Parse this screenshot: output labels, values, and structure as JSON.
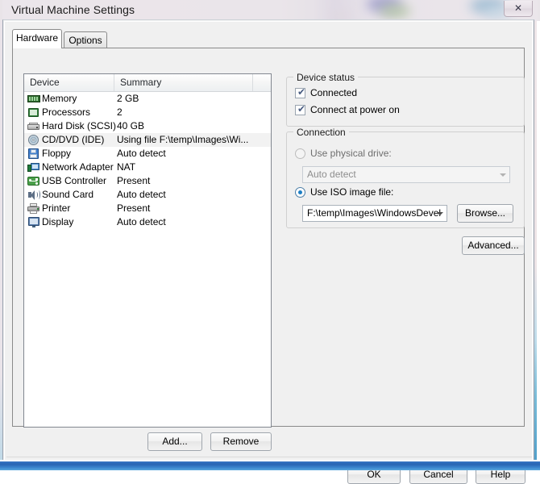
{
  "window": {
    "title": "Virtual Machine Settings",
    "close_label": "✕",
    "close_icon": "close-icon"
  },
  "tabs": [
    {
      "label": "Hardware",
      "active": true
    },
    {
      "label": "Options",
      "active": false
    }
  ],
  "device_list": {
    "columns": [
      "Device",
      "Summary",
      ""
    ],
    "rows": [
      {
        "icon": "memory-icon",
        "device": "Memory",
        "summary": "2 GB",
        "selected": false
      },
      {
        "icon": "processor-icon",
        "device": "Processors",
        "summary": "2",
        "selected": false
      },
      {
        "icon": "hard-disk-icon",
        "device": "Hard Disk (SCSI)",
        "summary": "40 GB",
        "selected": false
      },
      {
        "icon": "cd-dvd-icon",
        "device": "CD/DVD (IDE)",
        "summary": "Using file F:\\temp\\Images\\Wi...",
        "selected": true
      },
      {
        "icon": "floppy-icon",
        "device": "Floppy",
        "summary": "Auto detect",
        "selected": false
      },
      {
        "icon": "network-adapter-icon",
        "device": "Network Adapter",
        "summary": "NAT",
        "selected": false
      },
      {
        "icon": "usb-controller-icon",
        "device": "USB Controller",
        "summary": "Present",
        "selected": false
      },
      {
        "icon": "sound-card-icon",
        "device": "Sound Card",
        "summary": "Auto detect",
        "selected": false
      },
      {
        "icon": "printer-icon",
        "device": "Printer",
        "summary": "Present",
        "selected": false
      },
      {
        "icon": "display-icon",
        "device": "Display",
        "summary": "Auto detect",
        "selected": false
      }
    ]
  },
  "device_status": {
    "title": "Device status",
    "connected": {
      "label": "Connected",
      "checked": true,
      "mark": "✔"
    },
    "connect_at_power_on": {
      "label": "Connect at power on",
      "checked": true,
      "mark": "✔"
    }
  },
  "connection": {
    "title": "Connection",
    "use_physical_drive": {
      "label": "Use physical drive:",
      "selected": false,
      "enabled": false,
      "value": "Auto detect"
    },
    "use_iso_image_file": {
      "label": "Use ISO image file:",
      "selected": true,
      "enabled": true,
      "value": "F:\\temp\\Images\\WindowsDevel"
    },
    "browse_label": "Browse..."
  },
  "buttons": {
    "advanced": "Advanced...",
    "add": "Add...",
    "remove": "Remove",
    "ok": "OK",
    "cancel": "Cancel",
    "help": "Help"
  },
  "colors": {
    "accent_radio": "#1d7ec4",
    "window_bg": "#f0f0f0",
    "list_bg": "#ffffff",
    "selection": "#f2f2f2",
    "aero_edge": "#2a66b4"
  }
}
